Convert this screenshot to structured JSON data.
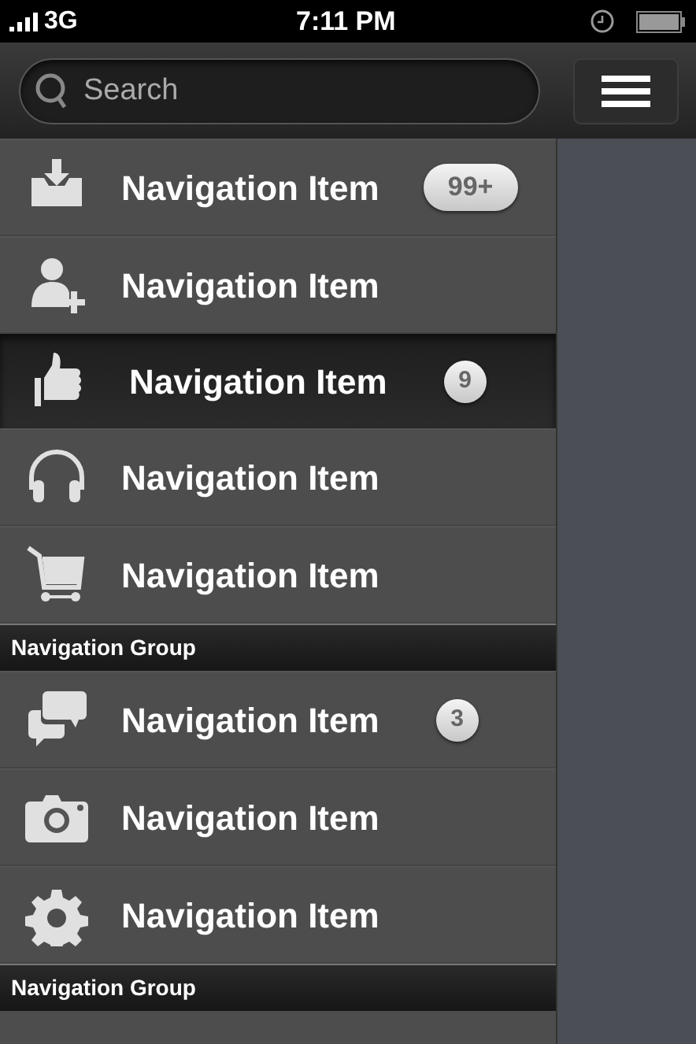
{
  "status_bar": {
    "carrier": "3G",
    "time": "7:11 PM"
  },
  "search": {
    "placeholder": "Search"
  },
  "sections": [
    {
      "items": [
        {
          "kind": "inbox",
          "label": "Navigation Item",
          "badge": "99+",
          "selected": false
        },
        {
          "kind": "add-user",
          "label": "Navigation Item",
          "selected": false
        },
        {
          "kind": "thumbs-up",
          "label": "Navigation Item",
          "badge": "9",
          "selected": true
        },
        {
          "kind": "headphones",
          "label": "Navigation Item",
          "selected": false
        },
        {
          "kind": "cart",
          "label": "Navigation Item",
          "selected": false
        }
      ]
    },
    {
      "title": "Navigation Group",
      "items": [
        {
          "kind": "chat",
          "label": "Navigation Item",
          "badge": "3",
          "selected": false
        },
        {
          "kind": "camera",
          "label": "Navigation Item",
          "selected": false
        },
        {
          "kind": "gear",
          "label": "Navigation Item",
          "selected": false
        }
      ]
    },
    {
      "title": "Navigation Group"
    }
  ]
}
